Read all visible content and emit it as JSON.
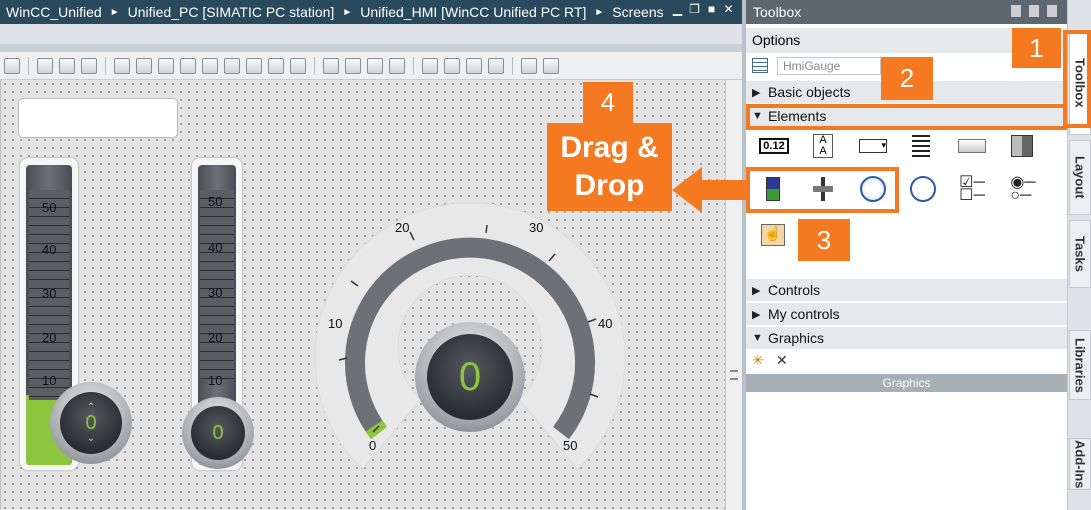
{
  "titlebar": {
    "breadcrumb": [
      "WinCC_Unified",
      "Unified_PC [SIMATIC PC station]",
      "Unified_HMI [WinCC Unified PC RT]",
      "Screens"
    ]
  },
  "toolbox": {
    "title": "Toolbox",
    "options_label": "Options",
    "search_placeholder": "HmiGauge",
    "sections": {
      "basic": "Basic objects",
      "elements": "Elements",
      "controls": "Controls",
      "my_controls": "My controls",
      "graphics": "Graphics"
    },
    "graphics_bar": "Graphics",
    "io_field_label": "0.12"
  },
  "side_tabs": [
    "Toolbox",
    "Layout",
    "Tasks",
    "Libraries",
    "Add-Ins"
  ],
  "canvas": {
    "slider1": {
      "ticks": [
        "50",
        "40",
        "30",
        "20",
        "10"
      ],
      "value": "0"
    },
    "slider2": {
      "ticks": [
        "50",
        "40",
        "30",
        "20",
        "10"
      ],
      "value": "0"
    },
    "gauge": {
      "scale": [
        "0",
        "10",
        "20",
        "30",
        "40",
        "50"
      ],
      "value": "0"
    }
  },
  "annotations": {
    "step1": "1",
    "step2": "2",
    "step3": "3",
    "step4": "4",
    "drag_drop": "Drag & Drop"
  },
  "colors": {
    "accent_orange": "#f47920",
    "value_green": "#8cc63f",
    "title_bar": "#294a5c"
  }
}
